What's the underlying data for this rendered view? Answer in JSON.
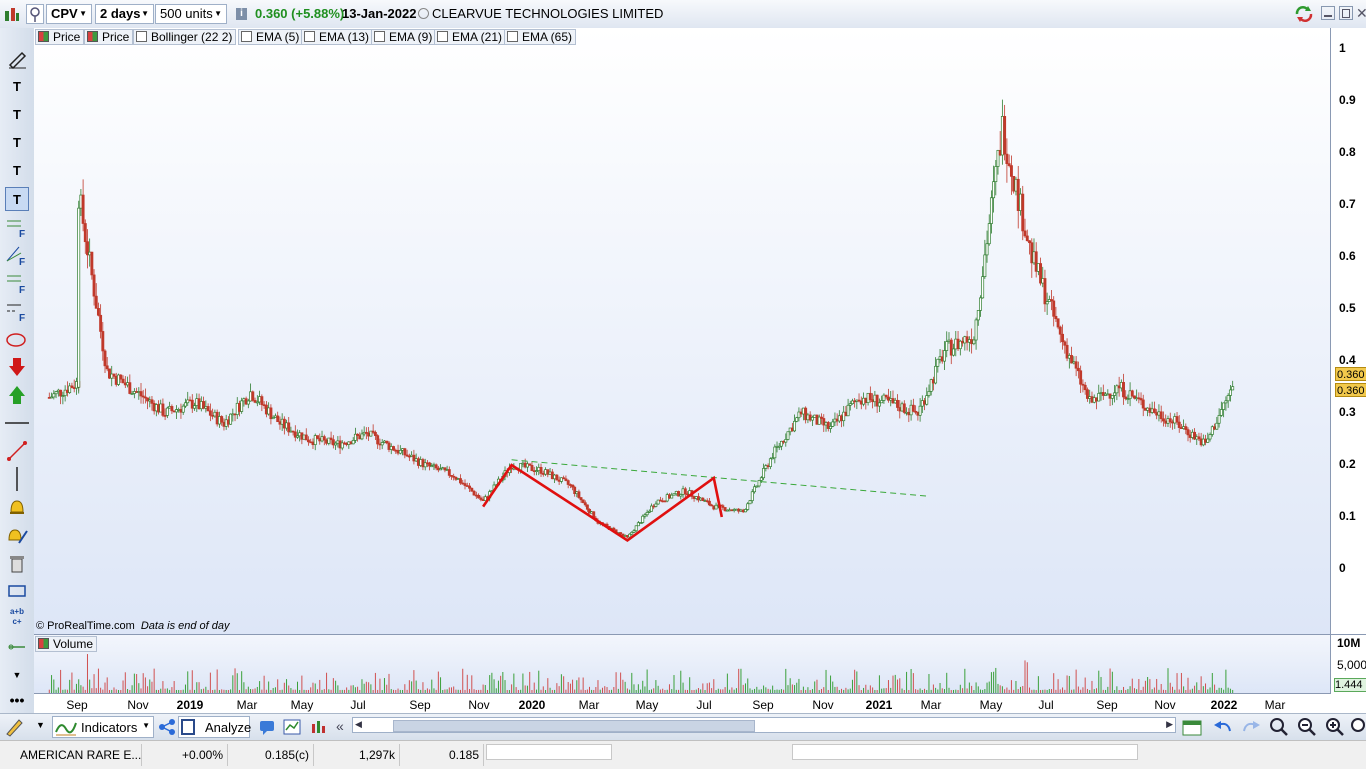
{
  "toolbar": {
    "symbol": "CPV",
    "period": "2 days",
    "units": "500 units",
    "last_price": "0.360 (+5.88%)",
    "date": "13-Jan-2022",
    "instrument_name": "CLEARVUE TECHNOLOGIES LIMITED"
  },
  "legend": [
    "Price",
    "Price",
    "Bollinger (22 2)",
    "EMA (5)",
    "EMA (13)",
    "EMA (9)",
    "EMA (21)",
    "EMA (65)"
  ],
  "price_axis": {
    "ticks": [
      "1",
      "0.9",
      "0.8",
      "0.7",
      "0.6",
      "0.5",
      "0.4",
      "0.3",
      "0.2",
      "0.1",
      "0"
    ],
    "current_badges": [
      "0.360",
      "0.360"
    ]
  },
  "copyright": "© ProRealTime.com",
  "copyright_note": "Data is end of day",
  "volume": {
    "label": "Volume",
    "ticks": [
      "10M",
      "5,000",
      "1.444"
    ]
  },
  "time_axis": [
    "Sep",
    "Nov",
    "2019",
    "Mar",
    "May",
    "Jul",
    "Sep",
    "Nov",
    "2020",
    "Mar",
    "May",
    "Jul",
    "Sep",
    "Nov",
    "2021",
    "Mar",
    "May",
    "Jul",
    "Sep",
    "Nov",
    "2022",
    "Mar"
  ],
  "bottom_toolbar": {
    "indicators_label": "Indicators",
    "analyze_label": "Analyze"
  },
  "statusbar": {
    "name": "AMERICAN RARE E...",
    "change": "+0.00%",
    "price": "0.185(c)",
    "volume": "1,297k",
    "last": "0.185"
  },
  "colors": {
    "up_candle": "#2e7d2e",
    "down_candle": "#c0392b",
    "pattern_line": "#e01010",
    "trend_line": "#3aa83a",
    "badge": "#f2c94c"
  },
  "chart_data": {
    "type": "candlestick",
    "y_range": [
      0,
      1
    ],
    "x_range": [
      "2018-08",
      "2022-03"
    ],
    "price_series": [
      [
        "2018-08",
        0.33
      ],
      [
        "2018-09",
        0.36
      ],
      [
        "2018-09",
        0.72
      ],
      [
        "2018-10",
        0.38
      ],
      [
        "2018-11",
        0.34
      ],
      [
        "2018-12",
        0.3
      ],
      [
        "2019-01",
        0.32
      ],
      [
        "2019-02",
        0.28
      ],
      [
        "2019-03",
        0.34
      ],
      [
        "2019-04",
        0.28
      ],
      [
        "2019-05",
        0.25
      ],
      [
        "2019-06",
        0.24
      ],
      [
        "2019-07",
        0.26
      ],
      [
        "2019-08",
        0.23
      ],
      [
        "2019-09",
        0.2
      ],
      [
        "2019-10",
        0.18
      ],
      [
        "2019-11",
        0.13
      ],
      [
        "2019-12",
        0.2
      ],
      [
        "2020-01",
        0.19
      ],
      [
        "2020-02",
        0.16
      ],
      [
        "2020-03",
        0.09
      ],
      [
        "2020-04",
        0.06
      ],
      [
        "2020-05",
        0.13
      ],
      [
        "2020-06",
        0.15
      ],
      [
        "2020-07",
        0.12
      ],
      [
        "2020-08",
        0.11
      ],
      [
        "2020-09",
        0.22
      ],
      [
        "2020-10",
        0.3
      ],
      [
        "2020-11",
        0.27
      ],
      [
        "2020-12",
        0.33
      ],
      [
        "2021-01",
        0.32
      ],
      [
        "2021-02",
        0.3
      ],
      [
        "2021-03",
        0.42
      ],
      [
        "2021-04",
        0.45
      ],
      [
        "2021-05",
        0.85
      ],
      [
        "2021-06",
        0.6
      ],
      [
        "2021-07",
        0.45
      ],
      [
        "2021-08",
        0.32
      ],
      [
        "2021-09",
        0.35
      ],
      [
        "2021-10",
        0.31
      ],
      [
        "2021-11",
        0.28
      ],
      [
        "2021-12",
        0.24
      ],
      [
        "2022-01",
        0.36
      ]
    ],
    "pattern": [
      [
        "2019-11",
        0.12
      ],
      [
        "2019-12",
        0.2
      ],
      [
        "2020-04",
        0.055
      ],
      [
        "2020-07",
        0.175
      ],
      [
        "2020-07",
        0.1
      ]
    ],
    "trend_line": [
      [
        "2019-12",
        0.21
      ],
      [
        "2021-02",
        0.14
      ]
    ],
    "ylabel": "",
    "xlabel": ""
  }
}
